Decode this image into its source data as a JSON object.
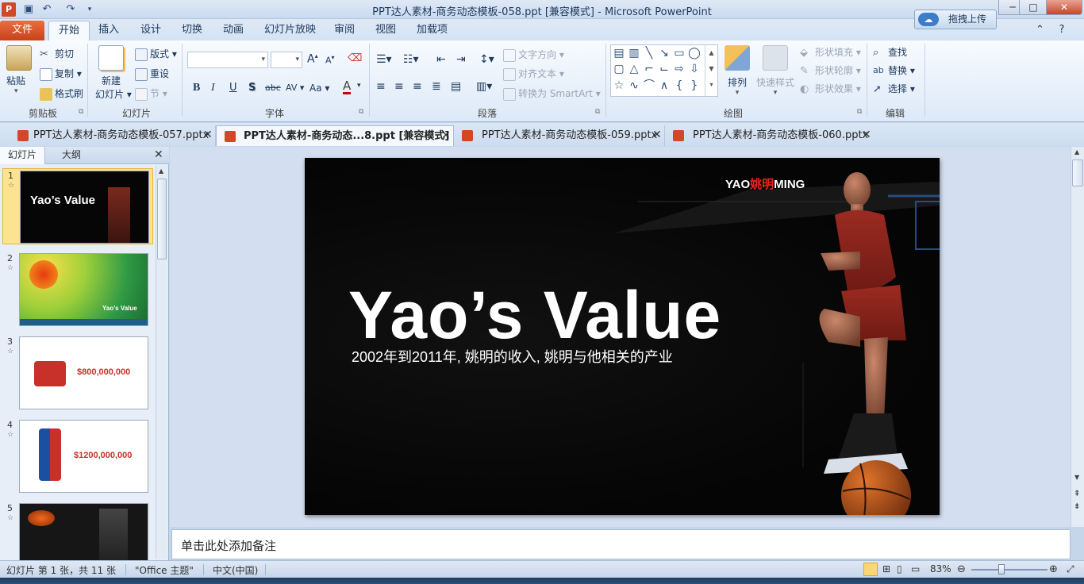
{
  "window": {
    "title": "PPT达人素材-商务动态模板-058.ppt [兼容模式] - Microsoft PowerPoint",
    "app_icon_letter": "P",
    "minimize": "─",
    "maximize": "□",
    "close": "✕"
  },
  "ribbon_tabs": [
    "文件",
    "开始",
    "插入",
    "设计",
    "切换",
    "动画",
    "幻灯片放映",
    "审阅",
    "视图",
    "加载项"
  ],
  "upload_button": "拖拽上传",
  "help_icon": "?",
  "ribbon": {
    "clipboard": {
      "paste": "粘贴",
      "cut": "剪切",
      "copy": "复制",
      "format_painter": "格式刷",
      "label": "剪贴板"
    },
    "slides": {
      "new_slide": "新建",
      "new_slide2": "幻灯片",
      "layout": "版式",
      "reset": "重设",
      "section": "节",
      "label": "幻灯片"
    },
    "font": {
      "bold": "B",
      "italic": "I",
      "underline": "U",
      "shadow": "S",
      "strike": "abc",
      "spacing": "AV",
      "case": "Aa",
      "grow": "A",
      "shrink": "A",
      "color": "A",
      "label": "字体"
    },
    "paragraph": {
      "text_direction": "文字方向",
      "align_text": "对齐文本",
      "smartart": "转换为 SmartArt",
      "label": "段落"
    },
    "drawing": {
      "arrange": "排列",
      "quick_styles": "快速样式",
      "shape_fill": "形状填充",
      "shape_outline": "形状轮廓",
      "shape_effects": "形状效果",
      "label": "绘图"
    },
    "editing": {
      "find": "查找",
      "replace": "替换",
      "select": "选择",
      "label": "编辑"
    }
  },
  "doc_tabs": [
    {
      "label": "PPT达人素材-商务动态模板-057.pptx",
      "active": false
    },
    {
      "label": "PPT达人素材-商务动态...8.ppt [兼容模式]",
      "active": true
    },
    {
      "label": "PPT达人素材-商务动态模板-059.pptx",
      "active": false
    },
    {
      "label": "PPT达人素材-商务动态模板-060.pptx",
      "active": false
    }
  ],
  "left_pane": {
    "tab_slides": "幻灯片",
    "tab_outline": "大纲",
    "close": "✕",
    "thumbnails": [
      {
        "num": "1",
        "title": "Yao’s Value"
      },
      {
        "num": "2",
        "title": "Yao’s Value"
      },
      {
        "num": "3",
        "title": "$800,000,000"
      },
      {
        "num": "4",
        "title": "$1200,000,000"
      },
      {
        "num": "5",
        "title": ""
      }
    ]
  },
  "slide": {
    "logo_a": "YAO",
    "logo_b": "姚明",
    "logo_c": "MING",
    "title": "Yao’s Value",
    "subtitle": "2002年到2011年, 姚明的收入, 姚明与他相关的产业"
  },
  "notes_placeholder": "单击此处添加备注",
  "status": {
    "slide_info": "幻灯片 第 1 张，共 11 张",
    "theme": "\"Office 主题\"",
    "language": "中文(中国)",
    "zoom": "83%"
  }
}
